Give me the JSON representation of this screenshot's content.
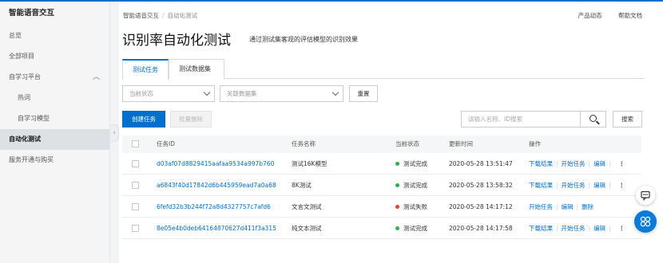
{
  "colors": {
    "accent": "#0070cc",
    "success": "#2bb24c",
    "fail": "#e5413b"
  },
  "sidebar": {
    "title": "智能语音交互",
    "items": [
      {
        "label": "总览",
        "sub": false,
        "active": false
      },
      {
        "label": "全部项目",
        "sub": false,
        "active": false
      },
      {
        "label": "自学习平台",
        "sub": false,
        "active": false,
        "expanded": true
      },
      {
        "label": "热词",
        "sub": true,
        "active": false
      },
      {
        "label": "自学习模型",
        "sub": true,
        "active": false
      },
      {
        "label": "自动化测试",
        "sub": false,
        "active": true
      },
      {
        "label": "服务开通与购买",
        "sub": false,
        "active": false
      }
    ]
  },
  "breadcrumb": {
    "root": "智能语音交互",
    "separator": "/",
    "current": "自动化测试"
  },
  "header_links": {
    "product_news": "产品动态",
    "help_docs": "帮助文档"
  },
  "page": {
    "title": "识别率自动化测试",
    "description": "通过测试集客观的评估模型的识别效果"
  },
  "tabs": [
    {
      "label": "测试任务",
      "active": true
    },
    {
      "label": "测试数据集",
      "active": false
    }
  ],
  "filters": {
    "status_placeholder": "当前状态",
    "dataset_placeholder": "关联数据集",
    "reset_label": "重置"
  },
  "actions": {
    "create_label": "创建任务",
    "batch_delete_label": "批量删除",
    "search_placeholder": "请输入名称、ID搜索",
    "search_label": "搜索"
  },
  "table": {
    "headers": {
      "id": "任务ID",
      "name": "任务名称",
      "status": "当前状态",
      "time": "更新时间",
      "ops": "操作"
    },
    "rows": [
      {
        "id": "d03af07d8829415aafaa9534a997b760",
        "name": "测试16K模型",
        "status": "测试完成",
        "status_type": "success",
        "time": "2020-05-28 13:51:47",
        "ops": [
          "下载结果",
          "开始任务",
          "编辑"
        ]
      },
      {
        "id": "a6843f40d17842d6b445959ead7a0a68",
        "name": "8K测试",
        "status": "测试完成",
        "status_type": "success",
        "time": "2020-05-28 13:58:32",
        "ops": [
          "下载结果",
          "开始任务",
          "编辑"
        ]
      },
      {
        "id": "6fefd32b3b244f72a8d4327757c7afd6",
        "name": "文言文测试",
        "status": "测试失败",
        "status_type": "fail",
        "time": "2020-05-28 14:17:12",
        "ops": [
          "开始任务",
          "编辑",
          "删除"
        ]
      },
      {
        "id": "8e05e4b0deb64164870627d411f3a315",
        "name": "纯文本测试",
        "status": "测试完成",
        "status_type": "success",
        "time": "2020-05-28 14:17:58",
        "ops": [
          "下载结果",
          "开始任务",
          "编辑"
        ]
      }
    ]
  }
}
